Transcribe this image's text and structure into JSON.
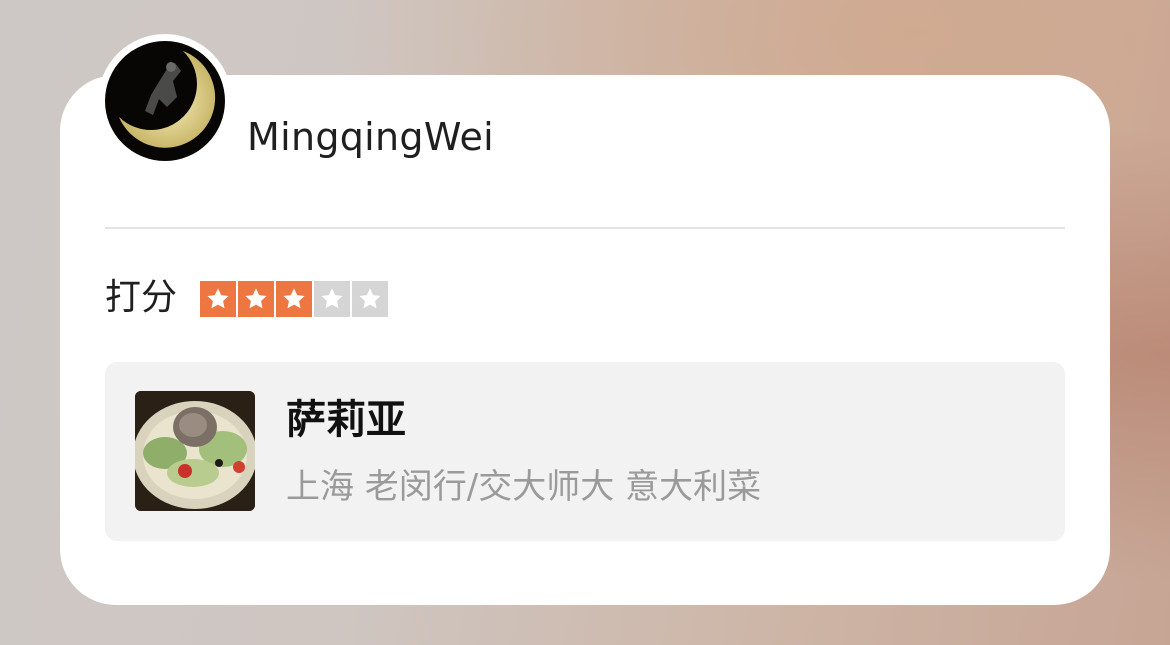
{
  "review": {
    "username": "MingqingWei",
    "rating_label": "打分",
    "rating": {
      "value": 3,
      "max": 5
    }
  },
  "shop": {
    "name": "萨莉亚",
    "meta": "上海 老闵行/交大师大 意大利菜"
  },
  "colors": {
    "star_on": "#ee7741",
    "star_off": "#d5d5d5",
    "card": "#ffffff",
    "shop_bg": "#f2f2f2"
  },
  "icons": {
    "star": "star-icon",
    "avatar": "avatar-image",
    "thumb": "shop-thumbnail"
  }
}
